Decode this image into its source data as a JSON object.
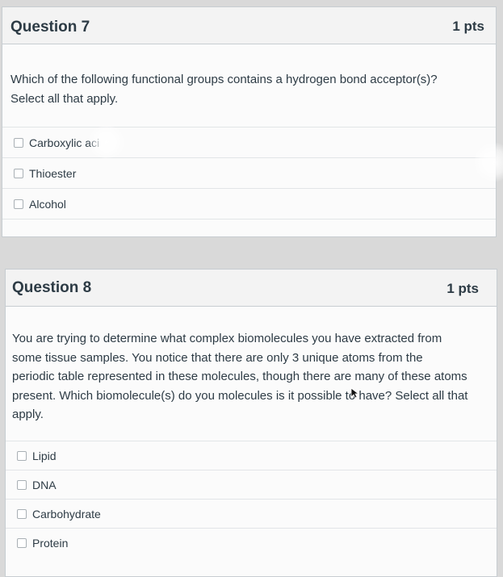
{
  "q7": {
    "title": "Question 7",
    "points": "1 pts",
    "text_line1": "Which of the following functional groups contains a hydrogen bond acceptor(s)?",
    "text_line2": "Select all that apply.",
    "options": [
      {
        "label": "Carboxylic aci"
      },
      {
        "label": "Thioester"
      },
      {
        "label": "Alcohol"
      }
    ]
  },
  "q8": {
    "title": "Question 8",
    "points": "1 pts",
    "text_lines": [
      "You are trying to determine what complex biomolecules you have extracted from",
      "some tissue samples. You notice that there are only 3 unique atoms from the",
      "periodic table represented in these molecules, though there are many of these atoms",
      "present. Which biomolecule(s) do you molecules is it possible to have? Select all that",
      "apply."
    ],
    "options": [
      {
        "label": "Lipid"
      },
      {
        "label": "DNA"
      },
      {
        "label": "Carbohydrate"
      },
      {
        "label": "Protein"
      }
    ]
  }
}
